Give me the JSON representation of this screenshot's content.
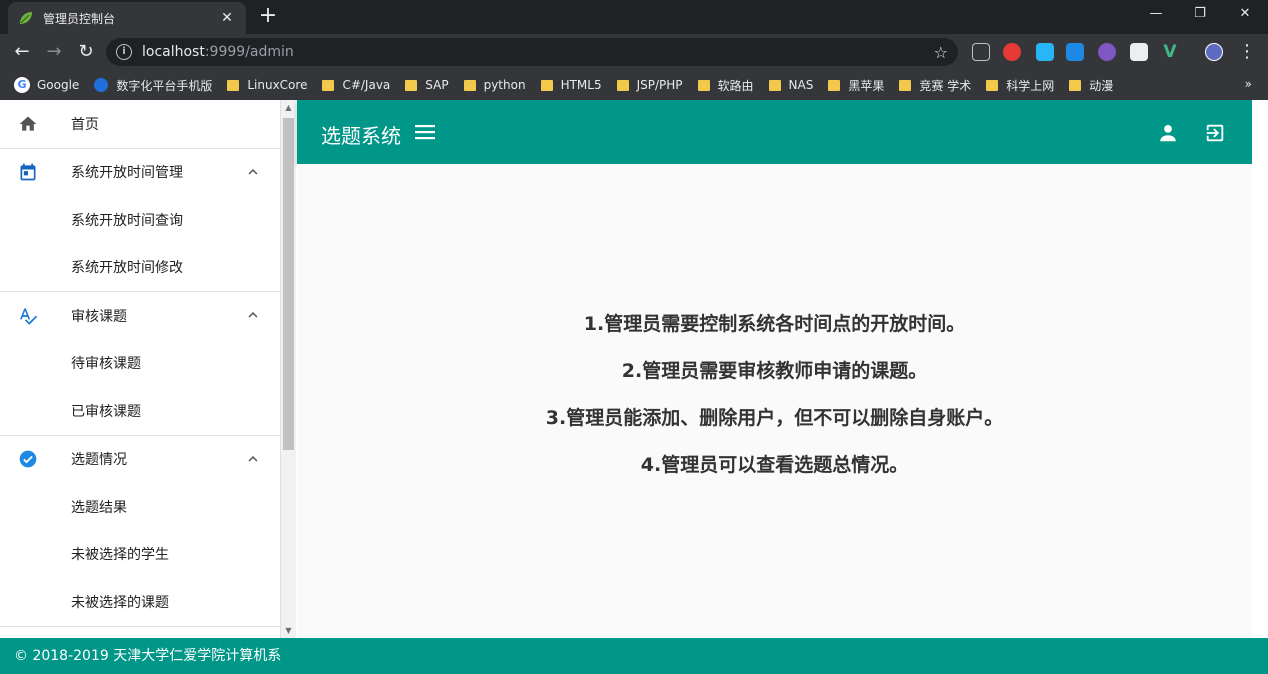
{
  "browser": {
    "tab_title": "管理员控制台",
    "tab_close": "✕",
    "new_tab": "+",
    "window_controls": {
      "minimize": "—",
      "restore": "❐",
      "close": "✕"
    },
    "nav": {
      "back": "←",
      "forward": "→",
      "reload": "↻"
    },
    "url_host": "localhost",
    "url_rest": ":9999/admin",
    "star": "☆",
    "more": "⋮",
    "bookmarks": [
      {
        "label": "Google",
        "icon": "google-icon"
      },
      {
        "label": "数字化平台手机版",
        "icon": "globe-icon"
      },
      {
        "label": "LinuxCore",
        "icon": "folder-icon"
      },
      {
        "label": "C#/Java",
        "icon": "folder-icon"
      },
      {
        "label": "SAP",
        "icon": "folder-icon"
      },
      {
        "label": "python",
        "icon": "folder-icon"
      },
      {
        "label": "HTML5",
        "icon": "folder-icon"
      },
      {
        "label": "JSP/PHP",
        "icon": "folder-icon"
      },
      {
        "label": "软路由",
        "icon": "folder-icon"
      },
      {
        "label": "NAS",
        "icon": "folder-icon"
      },
      {
        "label": "黑苹果",
        "icon": "folder-icon"
      },
      {
        "label": "竞赛 学术",
        "icon": "folder-icon"
      },
      {
        "label": "科学上网",
        "icon": "folder-icon"
      },
      {
        "label": "动漫",
        "icon": "folder-icon"
      }
    ],
    "bookmarks_more": "»"
  },
  "sidebar": {
    "home": "首页",
    "groups": [
      {
        "label": "系统开放时间管理",
        "icon": "calendar-icon",
        "items": [
          "系统开放时间查询",
          "系统开放时间修改"
        ]
      },
      {
        "label": "审核课题",
        "icon": "spellcheck-icon",
        "items": [
          "待审核课题",
          "已审核课题"
        ]
      },
      {
        "label": "选题情况",
        "icon": "check-circle-icon",
        "items": [
          "选题结果",
          "未被选择的学生",
          "未被选择的课题"
        ]
      }
    ]
  },
  "appbar": {
    "title": "选题系统"
  },
  "main": {
    "rules": [
      "1.管理员需要控制系统各时间点的开放时间。",
      "2.管理员需要审核教师申请的课题。",
      "3.管理员能添加、删除用户，但不可以删除自身账户。",
      "4.管理员可以查看选题总情况。"
    ]
  },
  "footer": {
    "text": "© 2018-2019 天津大学仁爱学院计算机系"
  },
  "colors": {
    "primary": "#009688",
    "browser_dark": "#202124",
    "browser_toolbar": "#35363a",
    "nav_icon": "#555555",
    "calendar": "#1565c0",
    "spellcheck": "#1976d2",
    "check_circle": "#1e88e5"
  }
}
